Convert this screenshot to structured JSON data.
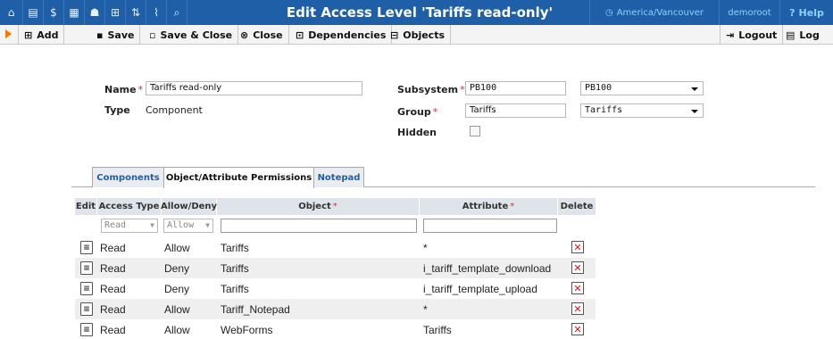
{
  "titlebar": {
    "title": "Edit Access Level 'Tariffs read-only'",
    "timezone": "America/Vancouver",
    "user": "demoroot",
    "help_label": "Help",
    "nav_icons": [
      "home-icon",
      "list-icon",
      "dollar-icon",
      "grid-icon",
      "person-icon",
      "hierarchy-icon",
      "route-icon",
      "chart-icon",
      "search-icon"
    ]
  },
  "toolbar": {
    "add_label": "Add",
    "save_label": "Save",
    "save_close_label": "Save & Close",
    "close_label": "Close",
    "dependencies_label": "Dependencies",
    "objects_label": "Objects",
    "logout_label": "Logout",
    "log_label": "Log"
  },
  "form": {
    "name_label": "Name",
    "name_value": "Tariffs read-only",
    "type_label": "Type",
    "type_value": "Component",
    "subsystem_label": "Subsystem",
    "subsystem_value": "PB100",
    "subsystem_select": "PB100",
    "group_label": "Group",
    "group_value": "Tariffs",
    "group_select": "Tariffs",
    "hidden_label": "Hidden",
    "hidden_checked": false
  },
  "tabs": [
    {
      "label": "Components",
      "active": false
    },
    {
      "label": "Object/Attribute Permissions",
      "active": true
    },
    {
      "label": "Notepad",
      "active": false
    }
  ],
  "grid": {
    "headers": {
      "edit": "Edit",
      "access_type": "Access Type",
      "allow_deny": "Allow/Deny",
      "object": "Object",
      "attribute": "Attribute",
      "delete": "Delete"
    },
    "filter": {
      "access_type": "Read",
      "allow_deny": "Allow",
      "object": "",
      "attribute": ""
    },
    "rows": [
      {
        "access_type": "Read",
        "allow_deny": "Allow",
        "object": "Tariffs",
        "attribute": "*"
      },
      {
        "access_type": "Read",
        "allow_deny": "Deny",
        "object": "Tariffs",
        "attribute": "i_tariff_template_download"
      },
      {
        "access_type": "Read",
        "allow_deny": "Deny",
        "object": "Tariffs",
        "attribute": "i_tariff_template_upload"
      },
      {
        "access_type": "Read",
        "allow_deny": "Allow",
        "object": "Tariff_Notepad",
        "attribute": "*"
      },
      {
        "access_type": "Read",
        "allow_deny": "Allow",
        "object": "WebForms",
        "attribute": "Tariffs"
      }
    ]
  },
  "colors": {
    "titlebar": "#1f5fa8",
    "accent_text": "#8fd0ff",
    "required": "#ee2233",
    "delete_x": "#e01010"
  }
}
